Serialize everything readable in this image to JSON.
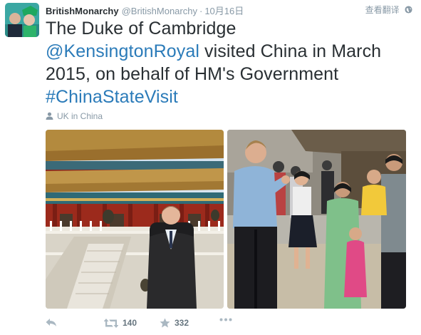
{
  "tweet": {
    "display_name": "BritishMonarchy",
    "screen_name": "@BritishMonarchy",
    "separator": "·",
    "timestamp": "10月16日",
    "translate_label": "查看翻译",
    "text_part1": "The Duke of Cambridge",
    "mention": "@KensingtonRoyal",
    "text_part2": " visited China in March 2015, on behalf of HM's Government",
    "hashtag": "#ChinaStateVisit",
    "location": "UK in China",
    "retweet_count": "140",
    "favorite_count": "332"
  },
  "icons": {
    "globe": "globe-icon",
    "location": "location-pin-icon",
    "reply": "reply-icon",
    "retweet": "retweet-icon",
    "favorite": "star-icon",
    "more": "more-dots-icon"
  },
  "colors": {
    "link": "#2b7bb9",
    "muted": "#8899a6"
  }
}
